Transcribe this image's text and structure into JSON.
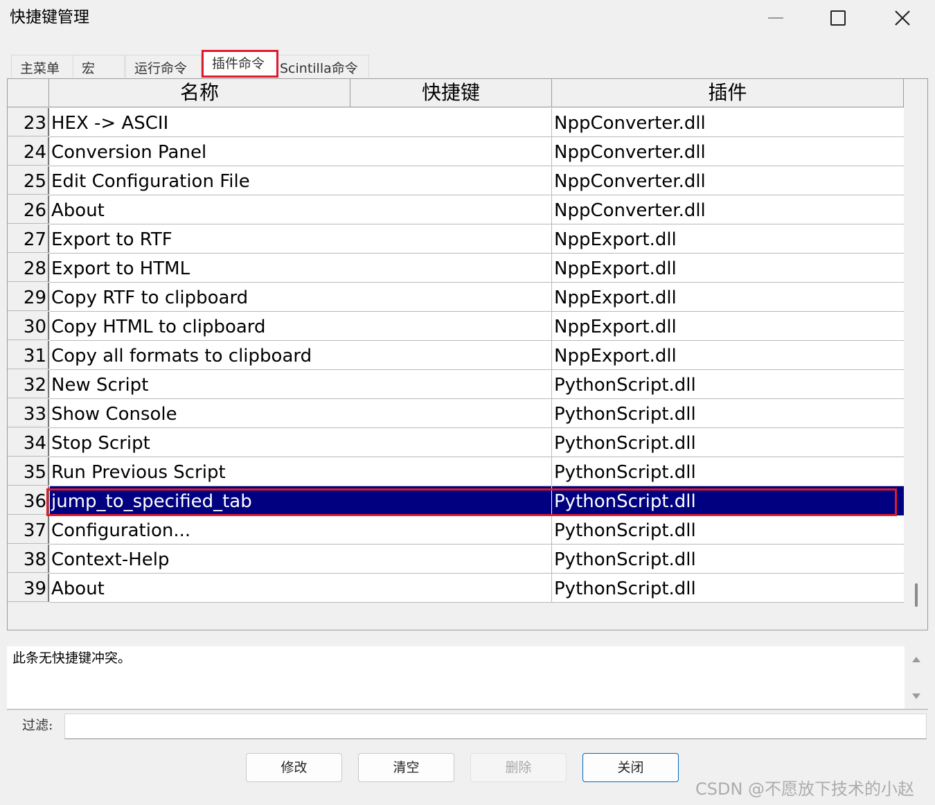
{
  "window": {
    "title": "快捷键管理"
  },
  "tabs": [
    {
      "label": "主菜单"
    },
    {
      "label": "宏"
    },
    {
      "label": "运行命令"
    },
    {
      "label": "插件命令",
      "active": true
    },
    {
      "label": "Scintilla命令"
    }
  ],
  "grid": {
    "columns": [
      "名称",
      "快捷键",
      "插件"
    ],
    "rows": [
      {
        "num": "23",
        "name": "HEX -> ASCII",
        "shortcut": "",
        "plugin": "NppConverter.dll"
      },
      {
        "num": "24",
        "name": "Conversion Panel",
        "shortcut": "",
        "plugin": "NppConverter.dll"
      },
      {
        "num": "25",
        "name": "Edit Configuration File",
        "shortcut": "",
        "plugin": "NppConverter.dll"
      },
      {
        "num": "26",
        "name": "About",
        "shortcut": "",
        "plugin": "NppConverter.dll"
      },
      {
        "num": "27",
        "name": "Export to RTF",
        "shortcut": "",
        "plugin": "NppExport.dll"
      },
      {
        "num": "28",
        "name": "Export to HTML",
        "shortcut": "",
        "plugin": "NppExport.dll"
      },
      {
        "num": "29",
        "name": "Copy RTF to clipboard",
        "shortcut": "",
        "plugin": "NppExport.dll"
      },
      {
        "num": "30",
        "name": "Copy HTML to clipboard",
        "shortcut": "",
        "plugin": "NppExport.dll"
      },
      {
        "num": "31",
        "name": "Copy all formats to clipboard",
        "shortcut": "",
        "plugin": "NppExport.dll"
      },
      {
        "num": "32",
        "name": "New Script",
        "shortcut": "",
        "plugin": "PythonScript.dll"
      },
      {
        "num": "33",
        "name": "Show Console",
        "shortcut": "",
        "plugin": "PythonScript.dll"
      },
      {
        "num": "34",
        "name": "Stop Script",
        "shortcut": "",
        "plugin": "PythonScript.dll"
      },
      {
        "num": "35",
        "name": "Run Previous Script",
        "shortcut": "",
        "plugin": "PythonScript.dll"
      },
      {
        "num": "36",
        "name": "jump_to_specified_tab",
        "shortcut": "",
        "plugin": "PythonScript.dll",
        "selected": true
      },
      {
        "num": "37",
        "name": "Configuration...",
        "shortcut": "",
        "plugin": "PythonScript.dll"
      },
      {
        "num": "38",
        "name": "Context-Help",
        "shortcut": "",
        "plugin": "PythonScript.dll"
      },
      {
        "num": "39",
        "name": "About",
        "shortcut": "",
        "plugin": "PythonScript.dll"
      }
    ]
  },
  "conflict_info": "此条无快捷键冲突。",
  "filter": {
    "label": "过滤:",
    "value": ""
  },
  "buttons": {
    "modify": "修改",
    "clear": "清空",
    "delete": "删除",
    "close": "关闭"
  },
  "watermark": "CSDN @不愿放下技术的小赵",
  "colors": {
    "selection_bg": "#000080",
    "highlight_outline": "#e01a2b"
  }
}
